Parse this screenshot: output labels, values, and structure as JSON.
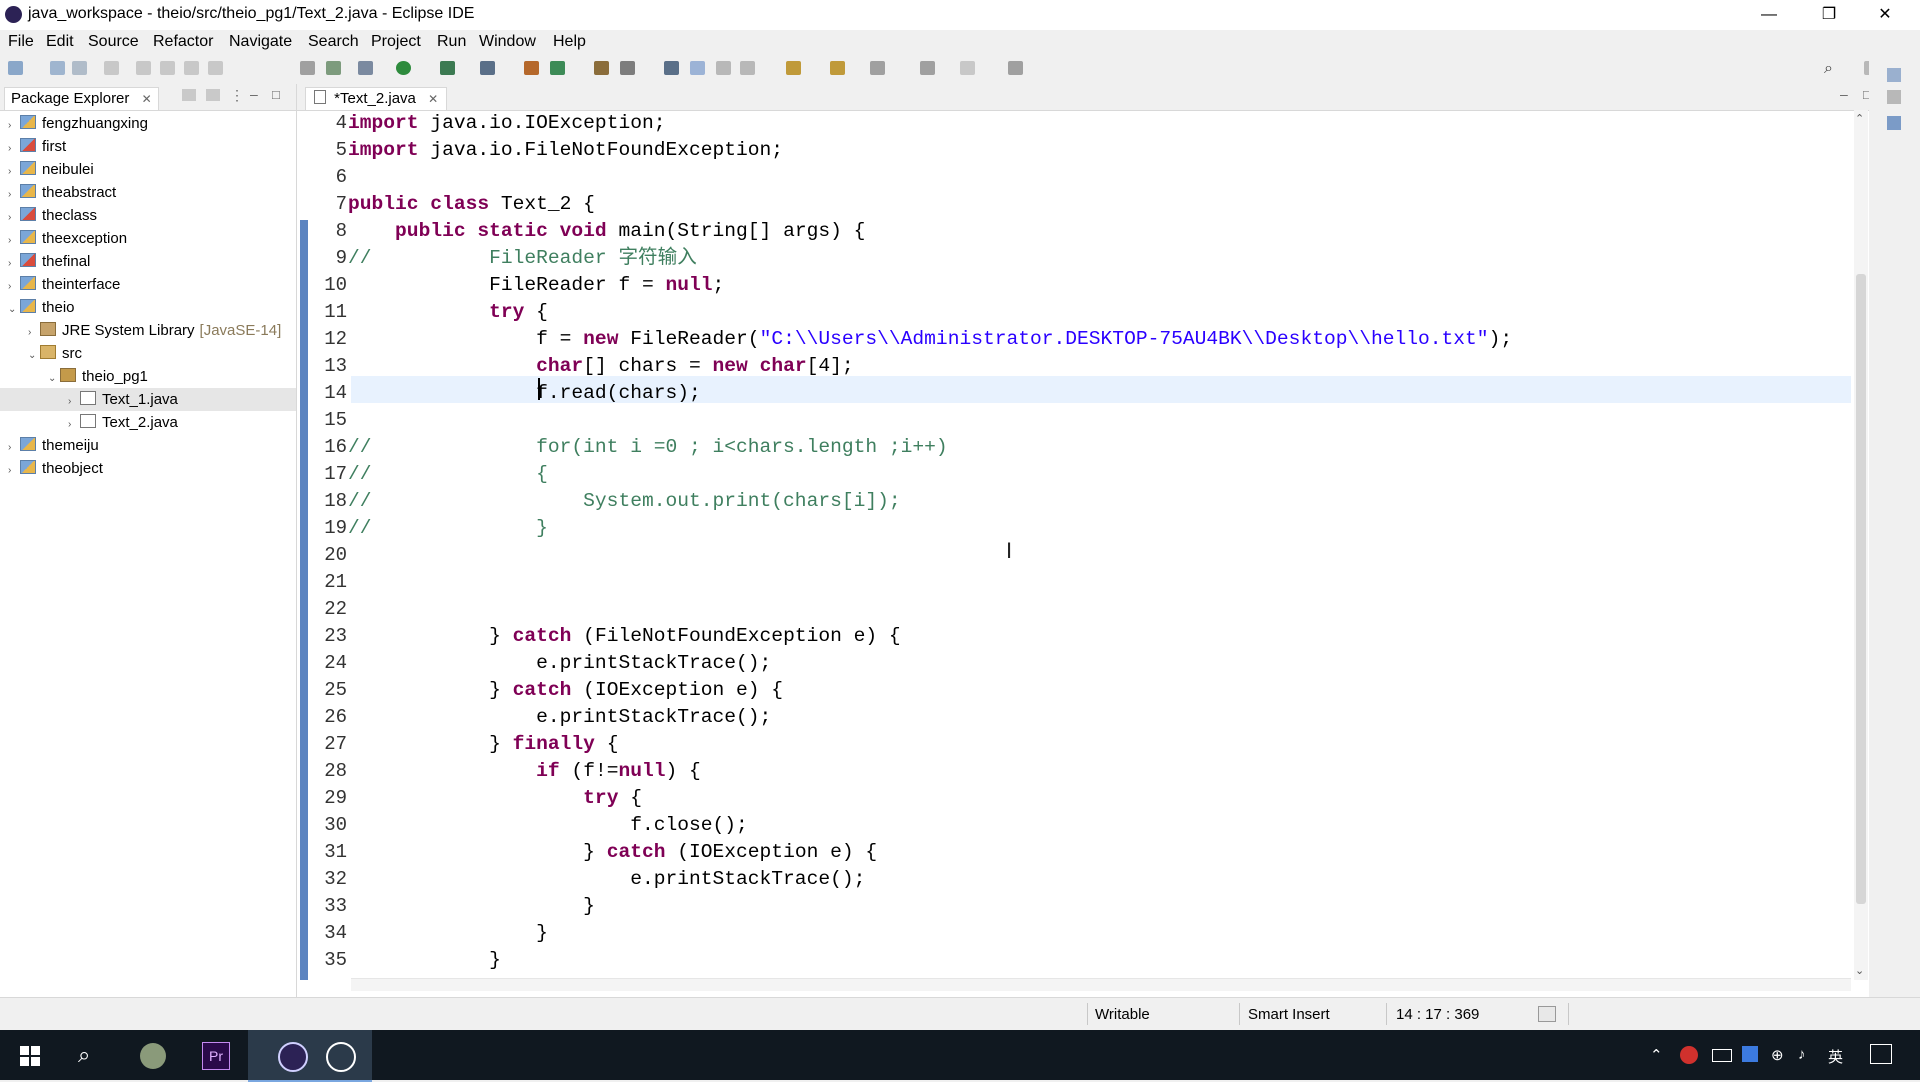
{
  "window": {
    "title": "java_workspace - theio/src/theio_pg1/Text_2.java - Eclipse IDE",
    "minimize": "—",
    "maximize": "❐",
    "close": "✕"
  },
  "menu": [
    "File",
    "Edit",
    "Source",
    "Refactor",
    "Navigate",
    "Search",
    "Project",
    "Run",
    "Window",
    "Help"
  ],
  "package_explorer": {
    "tab_label": "Package Explorer",
    "tree": [
      {
        "label": "fengzhuangxing",
        "icon": "project-icon",
        "twisty": "›"
      },
      {
        "label": "first",
        "icon": "project-error-icon",
        "twisty": "›"
      },
      {
        "label": "neibulei",
        "icon": "project-icon",
        "twisty": "›"
      },
      {
        "label": "theabstract",
        "icon": "project-icon",
        "twisty": "›"
      },
      {
        "label": "theclass",
        "icon": "project-error-icon",
        "twisty": "›"
      },
      {
        "label": "theexception",
        "icon": "project-icon",
        "twisty": "›"
      },
      {
        "label": "thefinal",
        "icon": "project-error-icon",
        "twisty": "›"
      },
      {
        "label": "theinterface",
        "icon": "project-icon",
        "twisty": "›"
      },
      {
        "label": "theio",
        "icon": "project-icon",
        "twisty": "⌄"
      },
      {
        "label": "JRE System Library",
        "decor": "[JavaSE-14]",
        "icon": "library-icon",
        "twisty": "›"
      },
      {
        "label": "src",
        "icon": "source-folder-icon",
        "twisty": "⌄"
      },
      {
        "label": "theio_pg1",
        "icon": "package-icon",
        "twisty": "⌄"
      },
      {
        "label": "Text_1.java",
        "icon": "java-file-icon",
        "twisty": "›"
      },
      {
        "label": "Text_2.java",
        "icon": "java-file-icon",
        "twisty": "›"
      },
      {
        "label": "themeiju",
        "icon": "project-icon",
        "twisty": "›"
      },
      {
        "label": "theobject",
        "icon": "project-icon",
        "twisty": "›"
      }
    ]
  },
  "editor": {
    "tab_label": "*Text_2.java",
    "lines": [
      {
        "n": "4",
        "html": "<span class=\"kw\">import</span> java.io.IOException;"
      },
      {
        "n": "5",
        "html": "<span class=\"kw\">import</span> java.io.FileNotFoundException;"
      },
      {
        "n": "6",
        "html": ""
      },
      {
        "n": "7",
        "html": "<span class=\"kw\">public class</span> Text_2 {"
      },
      {
        "n": "8",
        "html": "    <span class=\"kw\">public static void</span> main(String[] args) {"
      },
      {
        "n": "9",
        "html": "<span class=\"cm\">//          FileReader 字符输入</span>"
      },
      {
        "n": "10",
        "html": "            FileReader f = <span class=\"kw\">null</span>;"
      },
      {
        "n": "11",
        "html": "            <span class=\"kw\">try</span> {"
      },
      {
        "n": "12",
        "html": "                f = <span class=\"kw\">new</span> FileReader(<span class=\"str\">\"C:\\\\Users\\\\Administrator.DESKTOP-75AU4BK\\\\Desktop\\\\hello.txt\"</span>);"
      },
      {
        "n": "13",
        "html": "                <span class=\"kw\">char</span>[] chars = <span class=\"kw\">new char</span>[4];"
      },
      {
        "n": "14",
        "html": "                f.read(chars);"
      },
      {
        "n": "15",
        "html": ""
      },
      {
        "n": "16",
        "html": "<span class=\"cm\">//              for(int i =0 ; i&lt;chars.length ;i++)</span>"
      },
      {
        "n": "17",
        "html": "<span class=\"cm\">//              {</span>"
      },
      {
        "n": "18",
        "html": "<span class=\"cm\">//                  System.out.print(chars[i]);</span>"
      },
      {
        "n": "19",
        "html": "<span class=\"cm\">//              }</span>"
      },
      {
        "n": "20",
        "html": ""
      },
      {
        "n": "21",
        "html": ""
      },
      {
        "n": "22",
        "html": ""
      },
      {
        "n": "23",
        "html": "            } <span class=\"kw\">catch</span> (FileNotFoundException e) {"
      },
      {
        "n": "24",
        "html": "                e.printStackTrace();"
      },
      {
        "n": "25",
        "html": "            } <span class=\"kw\">catch</span> (IOException e) {"
      },
      {
        "n": "26",
        "html": "                e.printStackTrace();"
      },
      {
        "n": "27",
        "html": "            } <span class=\"kw\">finally</span> {"
      },
      {
        "n": "28",
        "html": "                <span class=\"kw\">if</span> (f!=<span class=\"kw\">null</span>) {"
      },
      {
        "n": "29",
        "html": "                    <span class=\"kw\">try</span> {"
      },
      {
        "n": "30",
        "html": "                        f.close();"
      },
      {
        "n": "31",
        "html": "                    } <span class=\"kw\">catch</span> (IOException e) {"
      },
      {
        "n": "32",
        "html": "                        e.printStackTrace();"
      },
      {
        "n": "33",
        "html": "                    }"
      },
      {
        "n": "34",
        "html": "                }"
      },
      {
        "n": "35",
        "html": "            }"
      }
    ]
  },
  "status": {
    "writable": "Writable",
    "insert_mode": "Smart Insert",
    "position": "14 : 17 : 369"
  },
  "taskbar": {
    "ime": "英"
  }
}
